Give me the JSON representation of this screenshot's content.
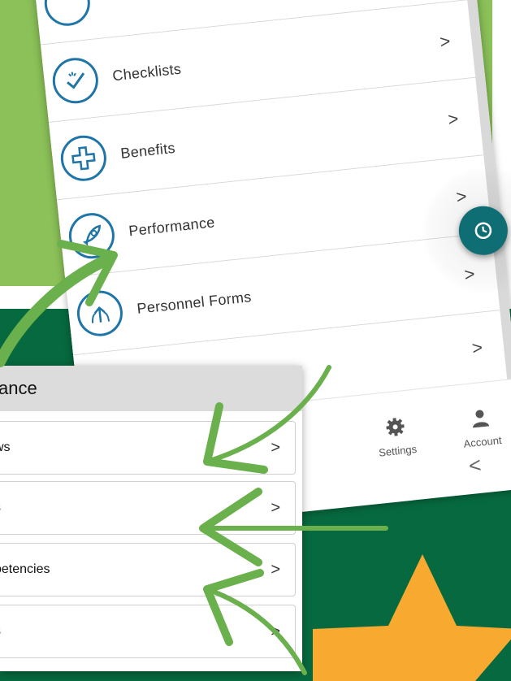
{
  "main_menu": {
    "items": [
      {
        "label": ""
      },
      {
        "label": "Checklists"
      },
      {
        "label": "Benefits"
      },
      {
        "label": "Performance"
      },
      {
        "label": "Personnel Forms"
      },
      {
        "label": ""
      }
    ],
    "chevron": ">"
  },
  "footer": {
    "settings_label": "Settings",
    "account_label": "Account",
    "back_glyph": "<"
  },
  "performance_panel": {
    "title": "ance",
    "items": [
      {
        "label": "ws"
      },
      {
        "label": "s"
      },
      {
        "label": "petencies"
      },
      {
        "label": "s"
      }
    ],
    "chevron": ">"
  },
  "colors": {
    "top_background": "#8bc158",
    "bottom_background": "#07693f",
    "arrow": "#6ab04c",
    "star": "#f7a930",
    "fab": "#0f6e73",
    "icon_stroke": "#1f75a8"
  }
}
